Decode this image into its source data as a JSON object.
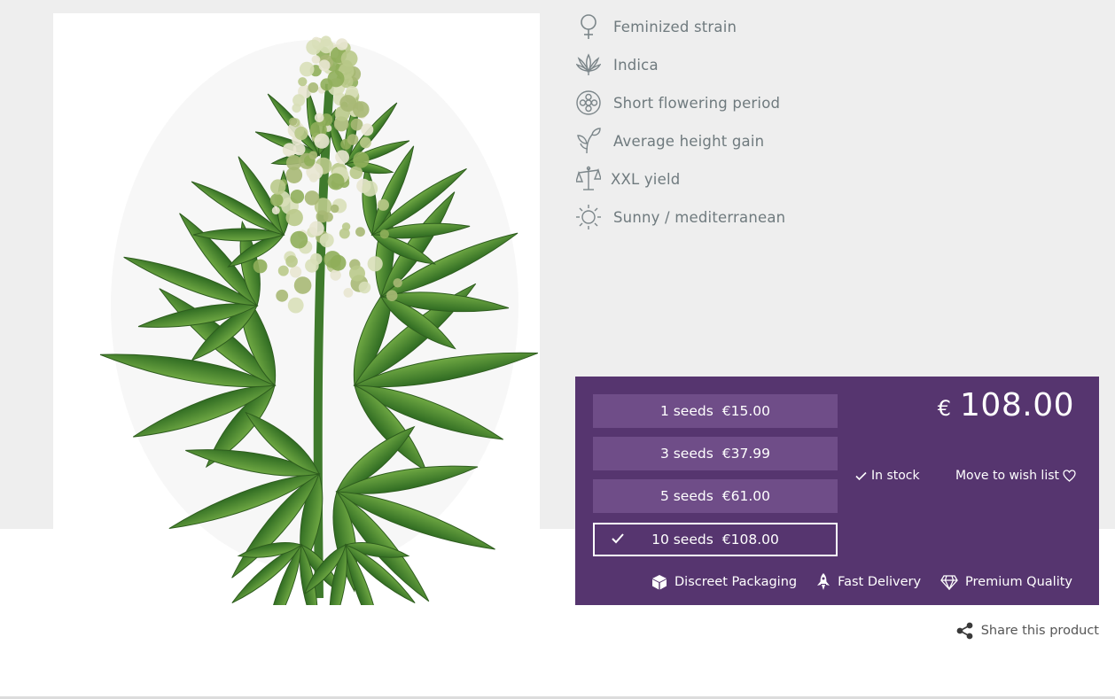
{
  "features": [
    {
      "icon": "female-symbol-icon",
      "label": "Feminized strain"
    },
    {
      "icon": "cannabis-leaf-icon",
      "label": "Indica"
    },
    {
      "icon": "flower-timer-icon",
      "label": "Short flowering period"
    },
    {
      "icon": "sprout-icon",
      "label": "Average height gain"
    },
    {
      "icon": "scale-icon",
      "label": "XXL yield"
    },
    {
      "icon": "sun-icon",
      "label": "Sunny / mediterranean"
    }
  ],
  "options": [
    {
      "seeds": "1 seeds",
      "price": "€15.00",
      "selected": false
    },
    {
      "seeds": "3 seeds",
      "price": "€37.99",
      "selected": false
    },
    {
      "seeds": "5 seeds",
      "price": "€61.00",
      "selected": false
    },
    {
      "seeds": "10 seeds",
      "price": "€108.00",
      "selected": true
    }
  ],
  "price": {
    "currency": "€",
    "amount": "108.00"
  },
  "stock": "In stock",
  "wishlist": "Move to wish list",
  "badges": [
    {
      "icon": "box-icon",
      "label": "Discreet Packaging"
    },
    {
      "icon": "rocket-icon",
      "label": "Fast Delivery"
    },
    {
      "icon": "diamond-icon",
      "label": "Premium Quality"
    }
  ],
  "share": "Share this product",
  "colors": {
    "panel": "#56356f",
    "option": "#6f4d88",
    "feature_text": "#6f7a7e",
    "background": "#eeeeee"
  }
}
